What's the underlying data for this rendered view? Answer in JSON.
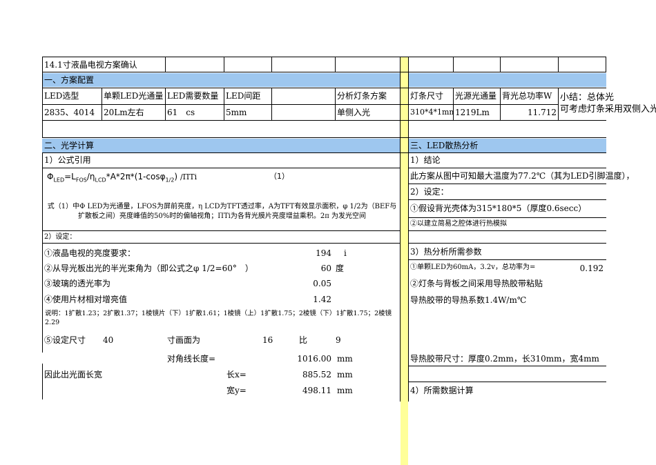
{
  "title": "14.1寸液晶电视方案确认",
  "section1": {
    "header": "一、方案配置",
    "columns": [
      "LED选型",
      "单颗LED光通量",
      "LED需要数量",
      "LED间距",
      "",
      "分析灯条方案",
      "灯条尺寸",
      "光源光通量",
      "背光总功率W"
    ],
    "values": [
      "2835、4014",
      "20Lm左右",
      "61　cs",
      "5mm",
      "",
      "单侧入光",
      "310*4*1mm",
      "1219Lm",
      "11.712"
    ],
    "summary_line1": "小结：总体光",
    "summary_line2": "可考虑灯条采用双侧入光"
  },
  "section2": {
    "header": "二、光学计算",
    "formula_title": "1）公式引用",
    "formula_parts": {
      "phi": "Φ",
      "led": "LED",
      "eq": "=L",
      "fos": "FOS",
      "slash": "/η",
      "lcd": "LCD",
      "rest": "*A*2π*(1-cosφ",
      "half": "1/2",
      "end": ")",
      "pi": "/ΠTi",
      "num": "（1）"
    },
    "formula_desc": "式（1）中Φ LED为光通量，LFOS为屏前亮度，η LCD为TFT透过率，A为TFT有效显示面积，φ 1/2为（BEF与 扩散板之间）亮度峰值的50%时的偏轴视角；ΠTi为各背光膜片亮度增益乘积。2π 为发光空间",
    "setting_title": "2）设定：",
    "items": [
      {
        "label": "①液晶电视的亮度要求：",
        "value": "194",
        "unit": "i"
      },
      {
        "label": "②从导光板出光的半光束角为（即公式之φ 1/2=60°　）",
        "value": "60",
        "unit": "度"
      },
      {
        "label": "③玻璃的透光率为",
        "value": "0.05",
        "unit": ""
      },
      {
        "label": "④使用片材相对增亮值",
        "value": "1.42",
        "unit": ""
      }
    ],
    "note": "说明：1扩散1.23；2扩散1.37；1棱镜片（下）1扩散1.61；1棱镜（上）1扩散1.75；2棱镜（下）1扩散1.75；2棱镜2.29",
    "size": {
      "label": "⑤设定尺寸",
      "size_value": "40",
      "ratio_label": "寸画面为",
      "ratio_a": "16",
      "ratio_word": "比",
      "ratio_b": "9"
    },
    "diagonal": {
      "label": "对角线长度=",
      "value": "1016.00",
      "unit": "mm"
    },
    "area_label": "因此出光面长宽",
    "length": {
      "label": "长x=",
      "value": "885.52",
      "unit": "mm"
    },
    "width": {
      "label": "宽y=",
      "value": "498.11",
      "unit": "mm"
    }
  },
  "section3": {
    "header": "三、LED散热分析",
    "conclusion_title": "1）结论",
    "conclusion": "此方案从图中可知最大温度为77.2℃（其为LED引脚温度），",
    "setting_title": "2）设定：",
    "assume1": "①假设背光壳体为315*180*5（厚度0.6secc）",
    "assume2": "②以建立简易之腔体进行热模拟",
    "params_title": "3）热分析所需参数",
    "param1_label": "①单颗LED为60mA，3.2v，总功率为=",
    "param1_value": "0.192",
    "param2": "②灯条与背板之间采用导热胶带粘贴",
    "param3": "导热胶带的导热系数1.4W/m℃",
    "tape": "导热胶带尺寸：厚度0.2mm，长310mm，宽4mm",
    "calc_title": "4）所需数据计算"
  }
}
